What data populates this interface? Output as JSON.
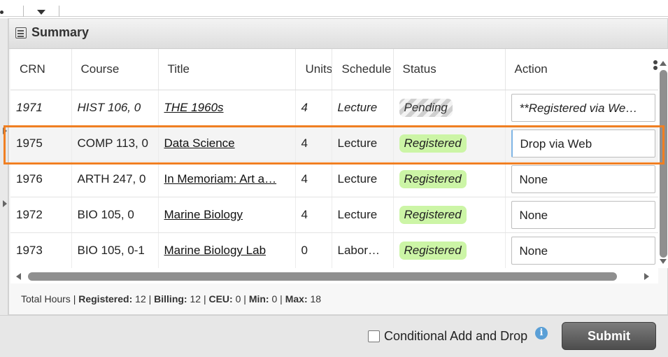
{
  "panel": {
    "title": "Summary"
  },
  "columns": [
    "CRN",
    "Course",
    "Title",
    "Units",
    "Schedule",
    "Status",
    "Action"
  ],
  "rows": [
    {
      "crn": "1971",
      "course": "HIST 106, 0",
      "title": "THE 1960s",
      "units": "4",
      "schedule": "Lecture",
      "status": "Pending",
      "action": "**Registered via We…"
    },
    {
      "crn": "1975",
      "course": "COMP 113, 0",
      "title": "Data Science",
      "units": "4",
      "schedule": "Lecture",
      "status": "Registered",
      "action": "Drop via Web"
    },
    {
      "crn": "1976",
      "course": "ARTH 247, 0",
      "title": "In Memoriam: Art a…",
      "units": "4",
      "schedule": "Lecture",
      "status": "Registered",
      "action": "None"
    },
    {
      "crn": "1972",
      "course": "BIO 105, 0",
      "title": "Marine Biology",
      "units": "4",
      "schedule": "Lecture",
      "status": "Registered",
      "action": "None"
    },
    {
      "crn": "1973",
      "course": "BIO 105, 0-1",
      "title": "Marine Biology Lab",
      "units": "0",
      "schedule": "Labor…",
      "status": "Registered",
      "action": "None"
    }
  ],
  "totals": {
    "label": "Total Hours",
    "registered_label": "Registered:",
    "registered": "12",
    "billing_label": "Billing:",
    "billing": "12",
    "ceu_label": "CEU:",
    "ceu": "0",
    "min_label": "Min:",
    "min": "0",
    "max_label": "Max:",
    "max": "18"
  },
  "footer": {
    "conditional_label": "Conditional Add and Drop",
    "info_glyph": "i",
    "submit_label": "Submit"
  },
  "colors": {
    "registered_badge": "#ccf5a6",
    "highlight": "#f07f22",
    "submit_button": "#5a5a5a"
  },
  "icons": [
    "summary-panel-icon",
    "info-icon",
    "column-menu-icon",
    "dropdown-arrow-icon"
  ]
}
